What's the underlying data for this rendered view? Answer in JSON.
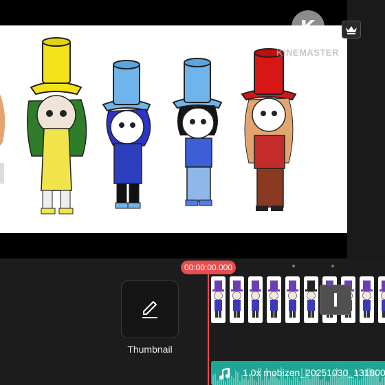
{
  "preview": {
    "watermark_text": "KINEMASTER",
    "watermark_logo": "K",
    "characters": [
      {
        "hat": "yellow",
        "hat_color": "#f3e21a",
        "outfit_color": "#f1e34a",
        "hair_color": "#2f7d2a"
      },
      {
        "hat": "light-blue",
        "hat_color": "#6fb4ea",
        "outfit_color": "#2b3fbf",
        "hair_color": "#2a34c9"
      },
      {
        "hat": "light-blue",
        "hat_color": "#6fb4ea",
        "outfit_color": "#3c5ed6",
        "hair_color": "#151515"
      },
      {
        "hat": "red",
        "hat_color": "#d71616",
        "outfit_color": "#c42c2c",
        "hair_color": "#e2a570"
      }
    ]
  },
  "premium_icon": "crown-icon",
  "timeline": {
    "timecode": "00:00:00.000",
    "thumbnail_button": {
      "label": "Thumbnail",
      "icon": "pencil-icon"
    },
    "video_clip_frames": 10,
    "audio_clip": {
      "label": "1.0x mobizen_20251030_131800",
      "icon": "music-note-icon"
    }
  },
  "colors": {
    "accent": "#ea4b4b",
    "audio_track": "#1fa595",
    "panel": "#1c1c1c"
  }
}
